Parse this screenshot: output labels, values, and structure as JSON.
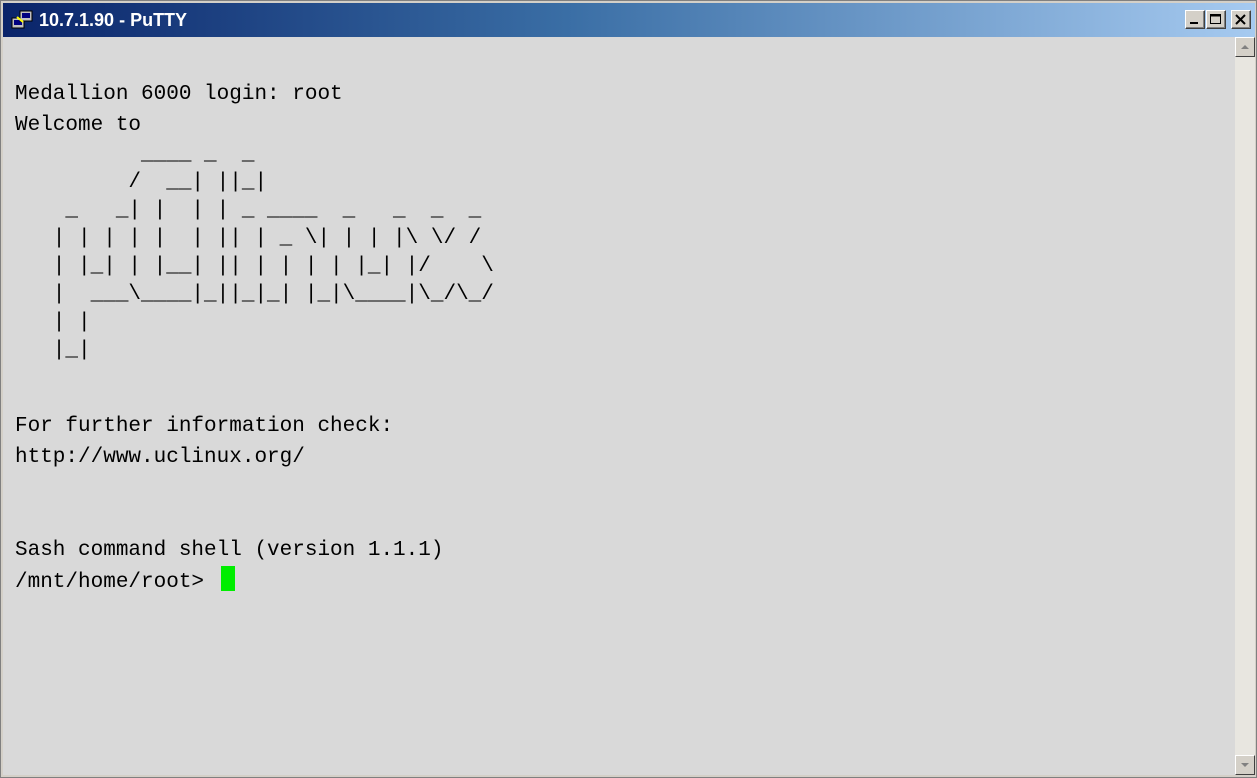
{
  "window": {
    "title": "10.7.1.90 - PuTTY",
    "app_icon": "putty-icon",
    "controls": {
      "minimize": "minimize-icon",
      "maximize": "maximize-icon",
      "close": "close-icon"
    }
  },
  "terminal": {
    "background": "#d9d9d9",
    "foreground": "#000000",
    "cursor_color": "#00ee00",
    "login_line": "Medallion 6000 login: root",
    "welcome_line": "Welcome to",
    "logo_ascii": "          ____ _  _\n         /  __| ||_|\n    _   _| |  | | _ ____  _   _  _  _\n   | | | | |  | || | _ \\| | | |\\ \\/ /\n   | |_| | |__| || | | | | |_| |/    \\\n   |  ___\\____|_||_|_| |_|\\____|\\_/\\_/\n   | |\n   |_|",
    "info_line": "For further information check:",
    "url_line": "http://www.uclinux.org/",
    "shell_line": "Sash command shell (version 1.1.1)",
    "prompt": "/mnt/home/root> "
  },
  "scrollbar": {
    "up_icon": "scroll-up-arrow-icon",
    "down_icon": "scroll-down-arrow-icon"
  }
}
